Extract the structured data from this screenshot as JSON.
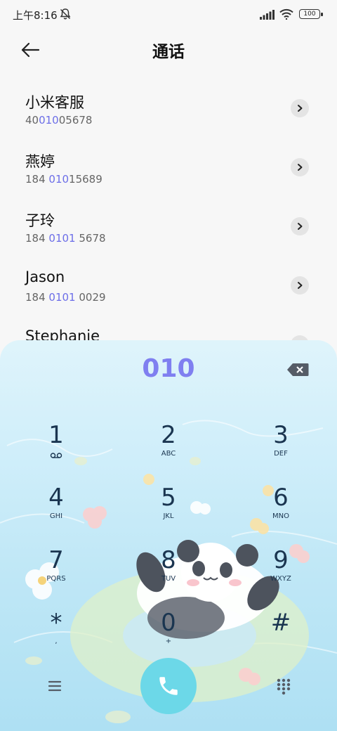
{
  "status": {
    "time": "上午8:16",
    "battery": "100"
  },
  "header": {
    "title": "通话"
  },
  "contacts": [
    {
      "name": "小米客服",
      "number_pre": "40",
      "number_hl": "010",
      "number_post": "05678"
    },
    {
      "name": "燕婷",
      "number_pre": "184 ",
      "number_hl": "010",
      "number_post": "15689"
    },
    {
      "name": "子玲",
      "number_pre": "184 ",
      "number_hl": "0101",
      "number_post": " 5678"
    },
    {
      "name": "Jason",
      "number_pre": "184 ",
      "number_hl": "0101",
      "number_post": " 0029"
    },
    {
      "name": "Stephanie",
      "number_pre": "",
      "number_hl": "",
      "number_post": ""
    }
  ],
  "dialpad": {
    "input": "010",
    "keys": [
      {
        "digit": "1",
        "letters": ""
      },
      {
        "digit": "2",
        "letters": "ABC"
      },
      {
        "digit": "3",
        "letters": "DEF"
      },
      {
        "digit": "4",
        "letters": "GHI"
      },
      {
        "digit": "5",
        "letters": "JKL"
      },
      {
        "digit": "6",
        "letters": "MNO"
      },
      {
        "digit": "7",
        "letters": "PQRS"
      },
      {
        "digit": "8",
        "letters": "TUV"
      },
      {
        "digit": "9",
        "letters": "WXYZ"
      },
      {
        "digit": "*",
        "letters": ","
      },
      {
        "digit": "0",
        "letters": "+"
      },
      {
        "digit": "#",
        "letters": ""
      }
    ]
  },
  "icons": {
    "back": "arrow-left-icon",
    "detail": "chevron-right-icon",
    "delete": "backspace-icon",
    "call": "phone-icon",
    "menu": "menu-icon",
    "keypad": "keypad-icon",
    "voicemail": "voicemail-icon"
  },
  "colors": {
    "highlight": "#6c6ee8",
    "call_button": "#6cd8e8",
    "digits": "#1a3550"
  }
}
